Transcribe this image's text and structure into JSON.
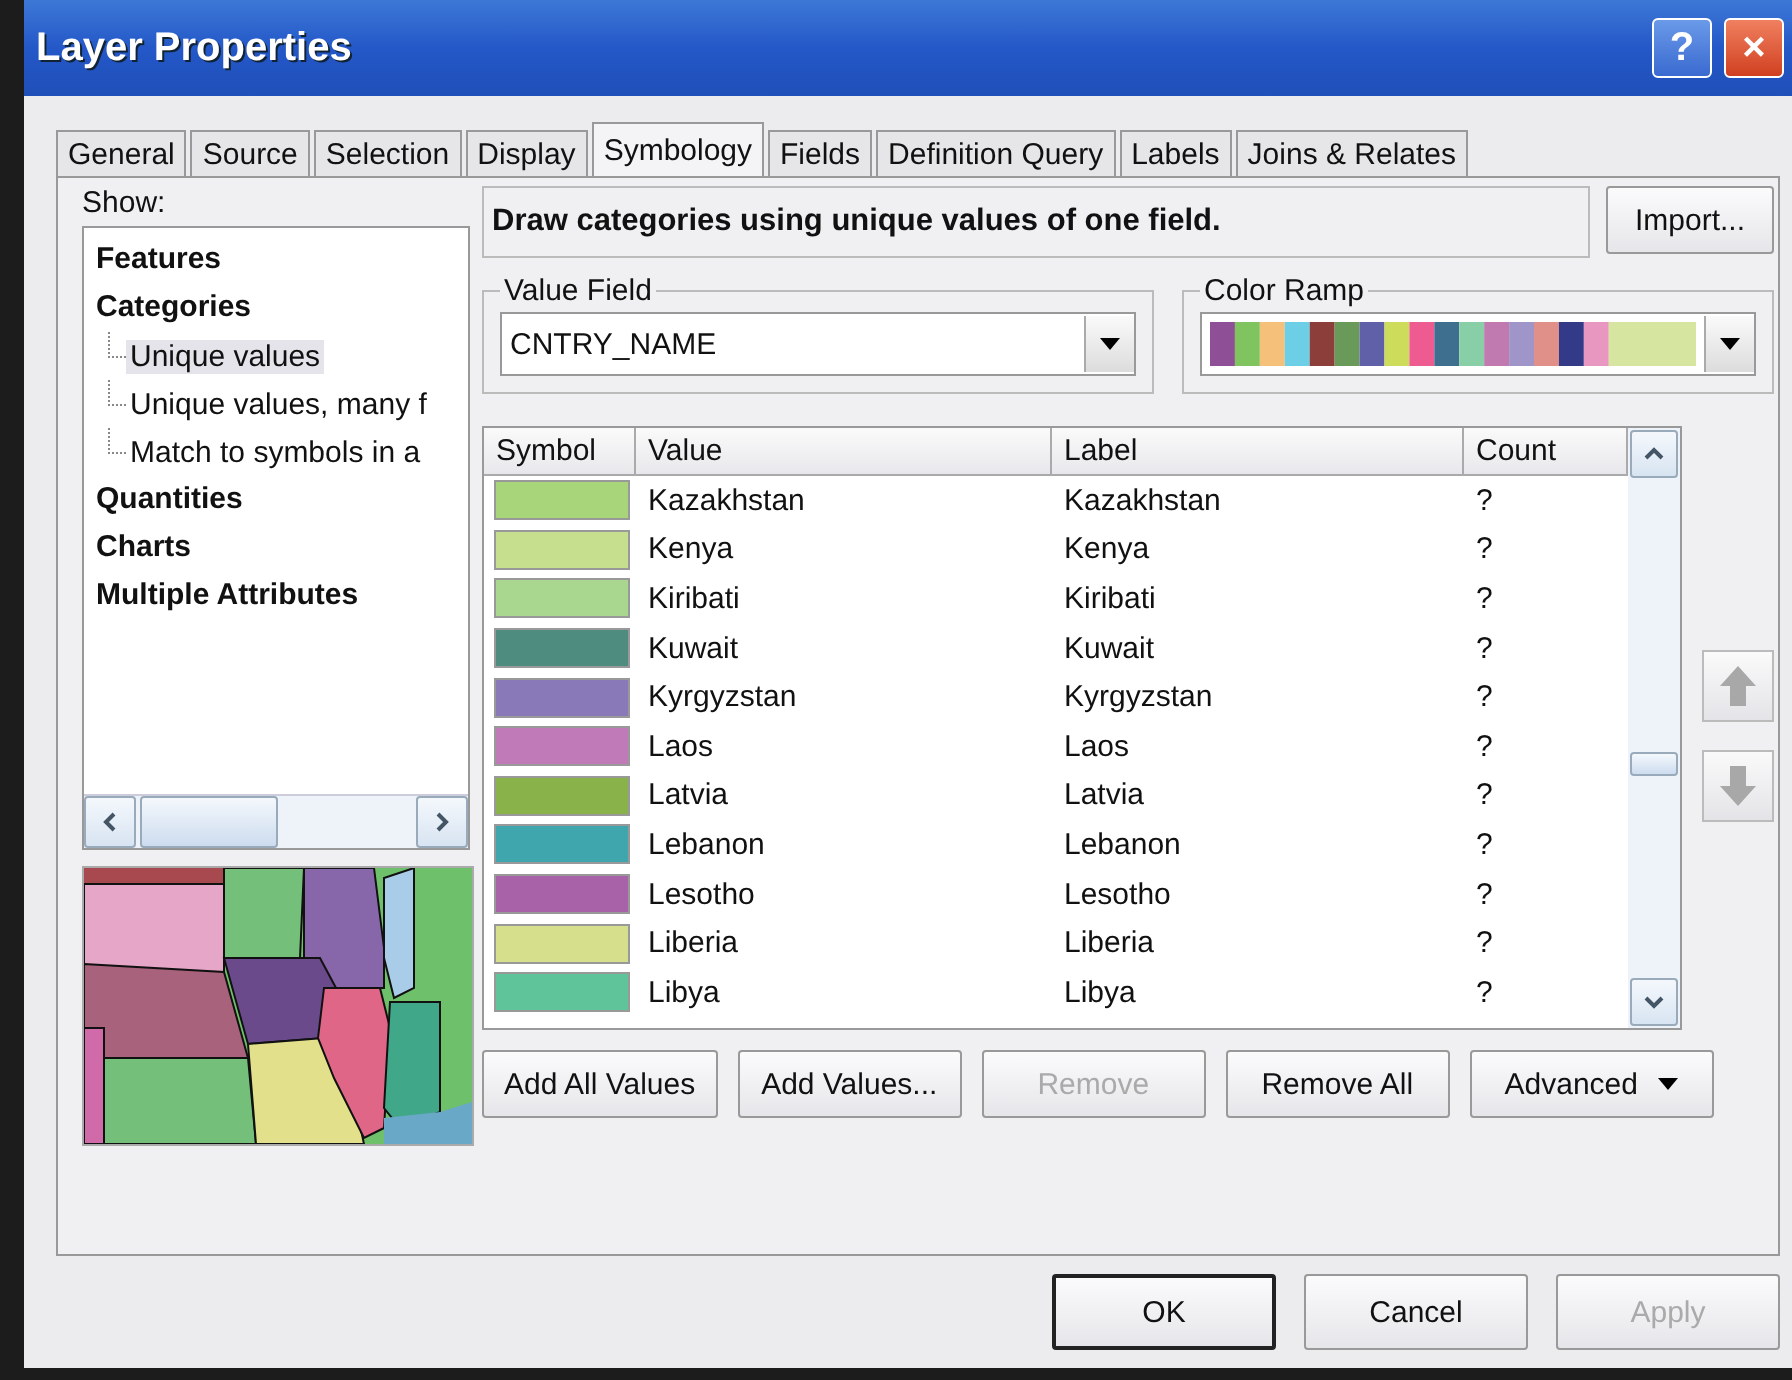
{
  "window": {
    "title": "Layer Properties",
    "help": "?",
    "close": "×"
  },
  "tabs": [
    {
      "label": "General",
      "selected": false
    },
    {
      "label": "Source",
      "selected": false
    },
    {
      "label": "Selection",
      "selected": false
    },
    {
      "label": "Display",
      "selected": false
    },
    {
      "label": "Symbology",
      "selected": true
    },
    {
      "label": "Fields",
      "selected": false
    },
    {
      "label": "Definition Query",
      "selected": false
    },
    {
      "label": "Labels",
      "selected": false
    },
    {
      "label": "Joins & Relates",
      "selected": false
    }
  ],
  "show": {
    "label": "Show:",
    "items": [
      {
        "label": "Features",
        "selected": false
      },
      {
        "label": "Categories",
        "selected": false,
        "children": [
          {
            "label": "Unique values",
            "selected": true
          },
          {
            "label": "Unique values, many f",
            "selected": false
          },
          {
            "label": "Match to symbols in a",
            "selected": false
          }
        ]
      },
      {
        "label": "Quantities",
        "selected": false
      },
      {
        "label": "Charts",
        "selected": false
      },
      {
        "label": "Multiple Attributes",
        "selected": false
      }
    ]
  },
  "description": "Draw categories using unique values of one field.",
  "import_button": "Import...",
  "value_field": {
    "label": "Value Field",
    "value": "CNTRY_NAME"
  },
  "color_ramp": {
    "label": "Color Ramp"
  },
  "table": {
    "columns": [
      "Symbol",
      "Value",
      "Label",
      "Count"
    ],
    "rows": [
      {
        "color": "#a8d57a",
        "value": "Kazakhstan",
        "label": "Kazakhstan",
        "count": "?"
      },
      {
        "color": "#c6df8e",
        "value": "Kenya",
        "label": "Kenya",
        "count": "?"
      },
      {
        "color": "#a9d78f",
        "value": "Kiribati",
        "label": "Kiribati",
        "count": "?"
      },
      {
        "color": "#4f8c80",
        "value": "Kuwait",
        "label": "Kuwait",
        "count": "?"
      },
      {
        "color": "#8a79b8",
        "value": "Kyrgyzstan",
        "label": "Kyrgyzstan",
        "count": "?"
      },
      {
        "color": "#c07ab8",
        "value": "Laos",
        "label": "Laos",
        "count": "?"
      },
      {
        "color": "#8ab24a",
        "value": "Latvia",
        "label": "Latvia",
        "count": "?"
      },
      {
        "color": "#3fa6ae",
        "value": "Lebanon",
        "label": "Lebanon",
        "count": "?"
      },
      {
        "color": "#a862a8",
        "value": "Lesotho",
        "label": "Lesotho",
        "count": "?"
      },
      {
        "color": "#d6e08c",
        "value": "Liberia",
        "label": "Liberia",
        "count": "?"
      },
      {
        "color": "#60c49a",
        "value": "Libya",
        "label": "Libya",
        "count": "?"
      }
    ]
  },
  "action_buttons": [
    {
      "label": "Add All Values",
      "disabled": false,
      "kind": "plain"
    },
    {
      "label": "Add Values...",
      "disabled": false,
      "kind": "plain"
    },
    {
      "label": "Remove",
      "disabled": true,
      "kind": "plain"
    },
    {
      "label": "Remove All",
      "disabled": false,
      "kind": "plain"
    },
    {
      "label": "Advanced",
      "disabled": false,
      "kind": "dropdown"
    }
  ],
  "dialog_buttons": [
    {
      "label": "OK",
      "disabled": false,
      "default": true
    },
    {
      "label": "Cancel",
      "disabled": false,
      "default": false
    },
    {
      "label": "Apply",
      "disabled": true,
      "default": false
    }
  ]
}
